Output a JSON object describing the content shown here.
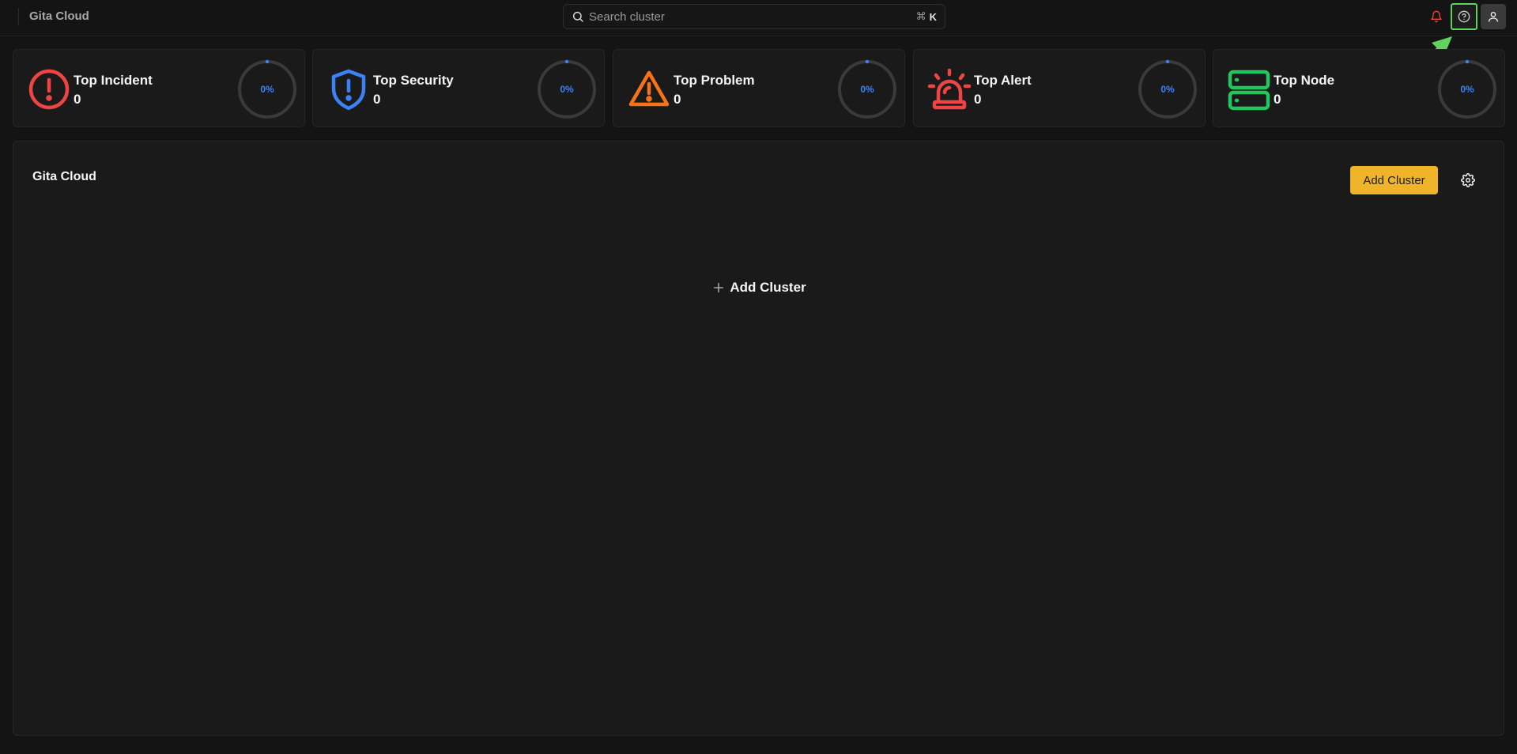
{
  "app": {
    "brand": "Gita Cloud"
  },
  "search": {
    "placeholder": "Search cluster",
    "shortcut_symbol": "⌘",
    "shortcut_key": "K"
  },
  "stats": [
    {
      "title": "Top Incident",
      "value": "0",
      "percent": "0%",
      "color": "#ef4444",
      "icon": "alert-circle-icon"
    },
    {
      "title": "Top Security",
      "value": "0",
      "percent": "0%",
      "color": "#3b82f6",
      "icon": "shield-alert-icon"
    },
    {
      "title": "Top Problem",
      "value": "0",
      "percent": "0%",
      "color": "#f97316",
      "icon": "alert-triangle-icon"
    },
    {
      "title": "Top Alert",
      "value": "0",
      "percent": "0%",
      "color": "#ef4444",
      "icon": "siren-icon"
    },
    {
      "title": "Top Node",
      "value": "0",
      "percent": "0%",
      "color": "#22c55e",
      "icon": "server-icon"
    }
  ],
  "panel": {
    "title": "Gita Cloud",
    "add_button": "Add Cluster",
    "empty_add": "Add Cluster"
  },
  "colors": {
    "accent": "#f0b429",
    "gauge_text": "#3b82f6",
    "highlight": "#5fd35a"
  }
}
